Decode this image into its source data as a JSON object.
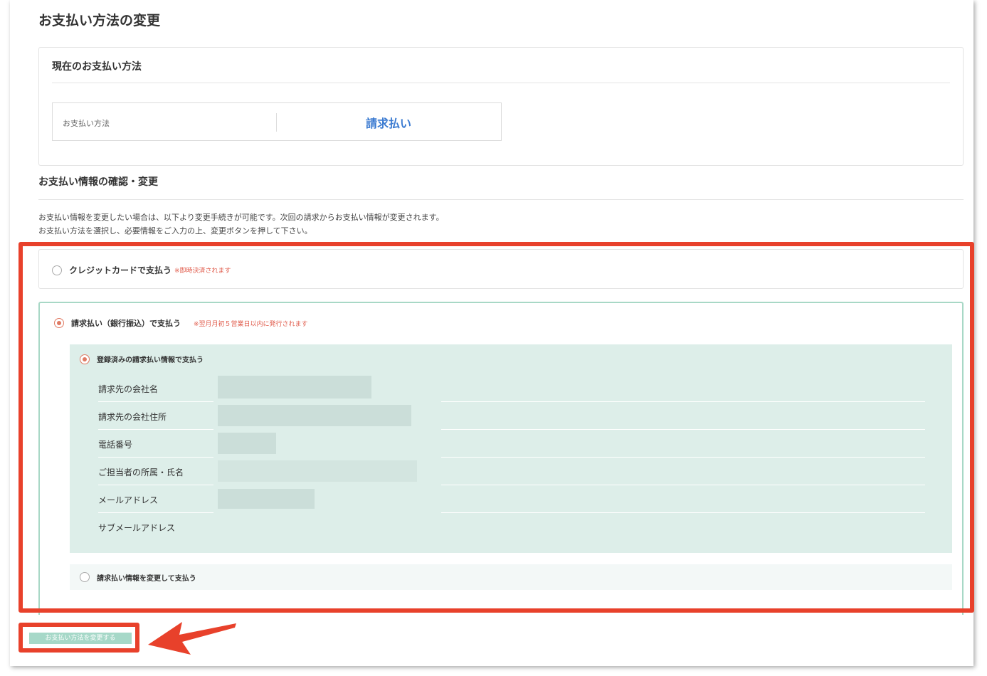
{
  "page_title": "お支払い方法の変更",
  "current": {
    "heading": "現在のお支払い方法",
    "method_label": "お支払い方法",
    "method_value": "請求払い"
  },
  "info": {
    "heading": "お支払い情報の確認・変更",
    "line1": "お支払い情報を変更したい場合は、以下より変更手続きが可能です。次回の請求からお支払い情報が変更されます。",
    "line2": "お支払い方法を選択し、必要情報をご入力の上、変更ボタンを押して下さい。"
  },
  "options": {
    "credit": {
      "label": "クレジットカードで支払う",
      "note": "※即時決済されます",
      "selected": false
    },
    "invoice": {
      "label": "請求払い（銀行振込）で支払う",
      "note": "※翌月月初５営業日以内に発行されます",
      "selected": true
    }
  },
  "registered": {
    "label": "登録済みの請求払い情報で支払う",
    "selected": true,
    "fields": [
      "請求先の会社名",
      "請求先の会社住所",
      "電話番号",
      "ご担当者の所属・氏名",
      "メールアドレス",
      "サブメールアドレス"
    ]
  },
  "change_option": {
    "label": "請求払い情報を変更して支払う",
    "selected": false
  },
  "submit": {
    "label": "お支払い方法を変更する"
  },
  "colors": {
    "accent_red": "#e8412b",
    "link_blue": "#3b7bd1",
    "panel_green": "#ddeee9",
    "button_green": "#a6d8c8"
  }
}
